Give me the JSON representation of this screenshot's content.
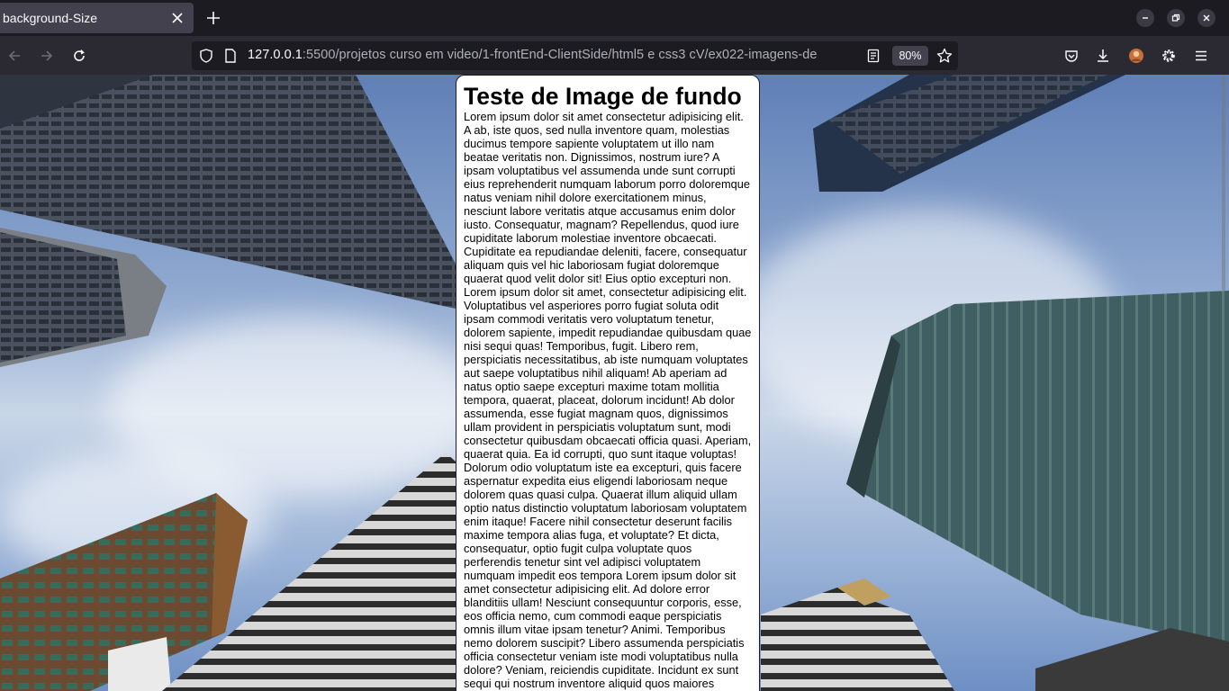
{
  "browser": {
    "tab_title": "background-Size",
    "url_host": "127.0.0.1",
    "url_path": ":5500/projetos curso em video/1-frontEnd-ClientSide/html5 e css3 cV/ex022-imagens-de",
    "zoom": "80%",
    "icons": {
      "tab_close": "close-icon",
      "new_tab": "plus-icon",
      "back": "arrow-left-icon",
      "forward": "arrow-right-icon",
      "reload": "reload-icon",
      "shield": "shield-icon",
      "page": "page-icon",
      "reader": "reader-view-icon",
      "bookmark": "star-icon",
      "pocket": "pocket-icon",
      "downloads": "download-icon",
      "account": "avatar",
      "extensions": "gear-icon",
      "menu": "hamburger-icon",
      "minimize": "minimize-icon",
      "restore": "restore-icon",
      "close_window": "close-icon"
    }
  },
  "page": {
    "heading": "Teste de Image de fundo",
    "body_text": "Lorem ipsum dolor sit amet consectetur adipisicing elit. A ab, iste quos, sed nulla inventore quam, molestias ducimus tempore sapiente voluptatem ut illo nam beatae veritatis non. Dignissimos, nostrum iure? A ipsam voluptatibus vel assumenda unde sunt corrupti eius reprehenderit numquam laborum porro doloremque natus veniam nihil dolore exercitationem minus, nesciunt labore veritatis atque accusamus enim dolor iusto. Consequatur, magnam? Repellendus, quod iure cupiditate laborum molestiae inventore obcaecati. Cupiditate ea repudiandae deleniti, facere, consequatur aliquam quis vel hic laboriosam fugiat doloremque quaerat quod velit dolor sit! Eius optio excepturi non. Lorem ipsum dolor sit amet, consectetur adipisicing elit. Voluptatibus vel asperiores porro fugiat soluta odit ipsam commodi veritatis vero voluptatum tenetur, dolorem sapiente, impedit repudiandae quibusdam quae nisi sequi quas! Temporibus, fugit. Libero rem, perspiciatis necessitatibus, ab iste numquam voluptates aut saepe voluptatibus nihil aliquam! Ab aperiam ad natus optio saepe excepturi maxime totam mollitia tempora, quaerat, placeat, dolorum incidunt! Ab dolor assumenda, esse fugiat magnam quos, dignissimos ullam provident in perspiciatis voluptatum sunt, modi consectetur quibusdam obcaecati officia quasi. Aperiam, quaerat quia. Ea id corrupti, quo sunt itaque voluptas! Dolorum odio voluptatum iste ea excepturi, quis facere aspernatur expedita eius eligendi laboriosam neque dolorem quas quasi culpa. Quaerat illum aliquid ullam optio natus distinctio voluptatum laboriosam voluptatem enim itaque! Facere nihil consectetur deserunt facilis maxime tempora alias fuga, et voluptate? Et dicta, consequatur, optio fugit culpa voluptate quos perferendis tenetur sint vel adipisci voluptatem numquam impedit eos tempora Lorem ipsum dolor sit amet consectetur adipisicing elit. Ad dolore error blanditiis ullam! Nesciunt consequuntur corporis, esse, eos officia nemo, cum commodi eaque perspiciatis omnis illum vitae ipsam tenetur? Animi. Temporibus nemo dolorem suscipit? Libero assumenda perspiciatis officia consectetur veniam iste modi voluptatibus nulla dolore? Veniam, reiciendis cupiditate. Incidunt ex sunt sequi qui nostrum inventore aliquid quos maiores",
    "background_image": "skyscrapers-photo"
  },
  "colors": {
    "tabstrip": "#1c1b22",
    "toolbar": "#2b2a33",
    "tab_active": "#42414d",
    "urlbar": "#1c1b22",
    "text_light": "#fbfbfe",
    "card_border": "#1a1a40"
  }
}
